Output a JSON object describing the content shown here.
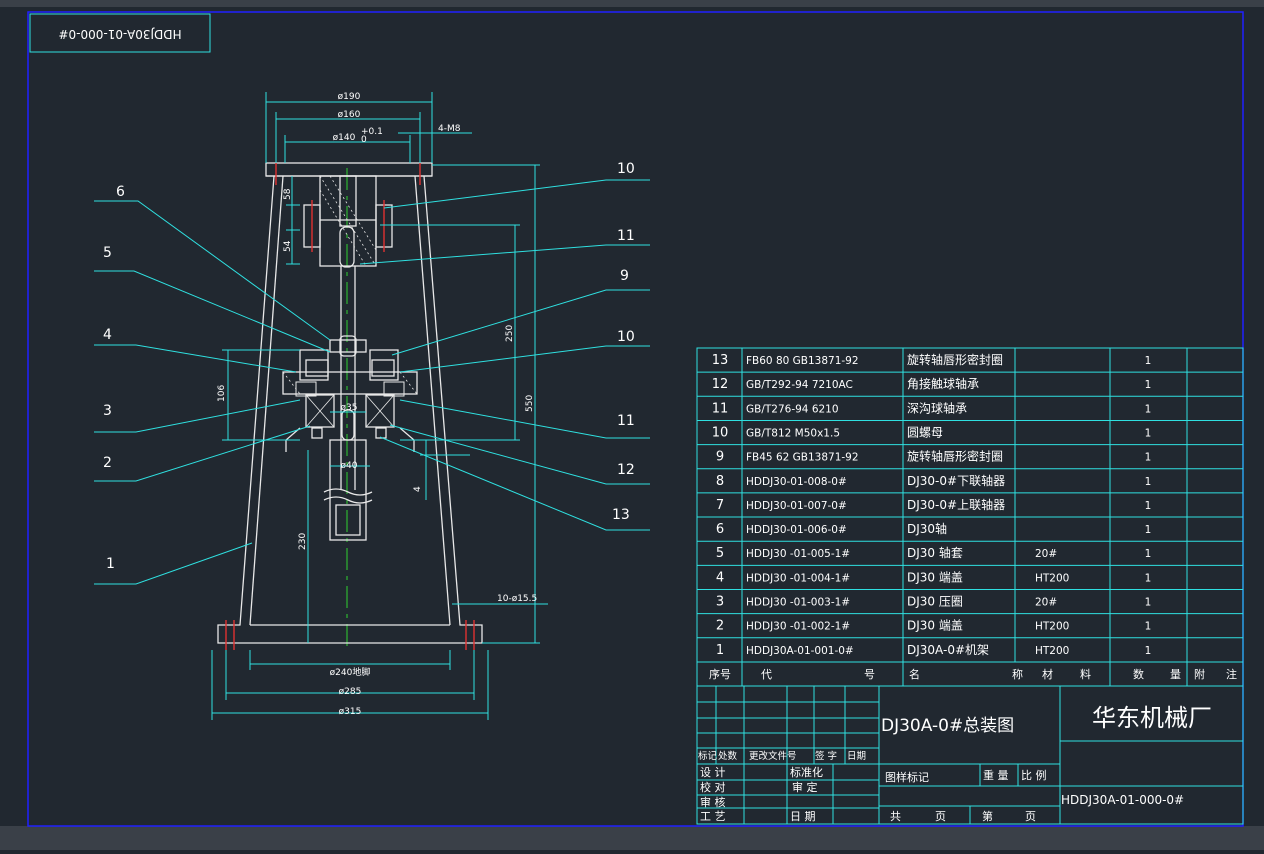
{
  "drawing": {
    "stamp_code": "HDDJ30A-01-000-0#",
    "dimensions": [
      "ø190",
      "ø160",
      "ø140",
      "+0.1",
      "0",
      "4-M8",
      "58",
      "54",
      "106",
      "250",
      "550",
      "ø35",
      "ø40",
      "230",
      "4",
      "10-ø15.5",
      "ø240地脚",
      "ø285",
      "ø315"
    ],
    "balloons": [
      "6",
      "5",
      "4",
      "3",
      "2",
      "1",
      "10",
      "11",
      "9",
      "10",
      "11",
      "12",
      "13"
    ]
  },
  "bom": {
    "rows": [
      {
        "no": "13",
        "code": "FB60 80 GB13871-92",
        "name": "旋转轴唇形密封圈",
        "material": "",
        "qty": "1"
      },
      {
        "no": "12",
        "code": "GB/T292-94 7210AC",
        "name": "角接触球轴承",
        "material": "",
        "qty": "1"
      },
      {
        "no": "11",
        "code": "GB/T276-94 6210",
        "name": "深沟球轴承",
        "material": "",
        "qty": "1"
      },
      {
        "no": "10",
        "code": "GB/T812 M50x1.5",
        "name": "圆螺母",
        "material": "",
        "qty": "1"
      },
      {
        "no": "9",
        "code": "FB45 62 GB13871-92",
        "name": "旋转轴唇形密封圈",
        "material": "",
        "qty": "1"
      },
      {
        "no": "8",
        "code": "HDDJ30-01-008-0#",
        "name": "DJ30-0#下联轴器",
        "material": "",
        "qty": "1"
      },
      {
        "no": "7",
        "code": "HDDJ30-01-007-0#",
        "name": "DJ30-0#上联轴器",
        "material": "",
        "qty": "1"
      },
      {
        "no": "6",
        "code": "HDDJ30-01-006-0#",
        "name": "DJ30轴",
        "material": "",
        "qty": "1"
      },
      {
        "no": "5",
        "code": "HDDJ30 -01-005-1#",
        "name": "DJ30 轴套",
        "material": "20#",
        "qty": "1"
      },
      {
        "no": "4",
        "code": "HDDJ30 -01-004-1#",
        "name": "DJ30 端盖",
        "material": "HT200",
        "qty": "1"
      },
      {
        "no": "3",
        "code": "HDDJ30 -01-003-1#",
        "name": "DJ30 压圈",
        "material": "20#",
        "qty": "1"
      },
      {
        "no": "2",
        "code": "HDDJ30 -01-002-1#",
        "name": "DJ30 端盖",
        "material": "HT200",
        "qty": "1"
      },
      {
        "no": "1",
        "code": "HDDJ30A-01-001-0#",
        "name": "DJ30A-0#机架",
        "material": "HT200",
        "qty": "1"
      }
    ],
    "header": {
      "no": "序号",
      "code_a": "代",
      "code_b": "号",
      "name_a": "名",
      "name_b": "称",
      "material_a": "材",
      "material_b": "料",
      "qty_a": "数",
      "qty_b": "量",
      "note_a": "附",
      "note_b": "注"
    }
  },
  "title_block": {
    "drawing_title": "DJ30A-0#总装图",
    "company": "华东机械厂",
    "drawing_code": "HDDJ30A-01-000-0#",
    "rev_labels": [
      "标记",
      "处数",
      "更改文件号",
      "签 字",
      "日期"
    ],
    "roles": [
      "设 计",
      "校 对",
      "审 核",
      "工 艺"
    ],
    "std": "标准化",
    "approve": "审 定",
    "date": "日 期",
    "stage_mark": "图样标记",
    "weight": "重 量",
    "scale": "比 例",
    "total": "共",
    "pages": "页",
    "sheet": "第",
    "page": "页"
  },
  "colors": {
    "background": "#212830",
    "lines": "#2fe0e0",
    "geometry": "#e8e8e8",
    "centerline": "#30d030",
    "bolt": "#e03030",
    "frame": "#2020ff"
  }
}
